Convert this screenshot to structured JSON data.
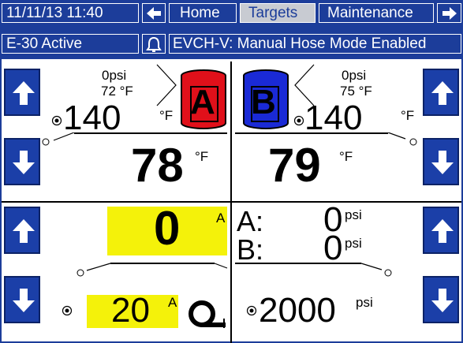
{
  "header": {
    "datetime": "11/11/13 11:40",
    "tabs": [
      "Home",
      "Targets",
      "Maintenance"
    ],
    "selected_tab": "Targets"
  },
  "status": {
    "error_code": "E-30 Active",
    "message": "EVCH-V: Manual Hose Mode Enabled"
  },
  "tank_a": {
    "label": "A",
    "pressure": "0psi",
    "actual_temp": "72 °F",
    "setpoint": "140",
    "setpoint_unit": "°F",
    "current": "78",
    "current_unit": "°F",
    "color": "#e0101a"
  },
  "tank_b": {
    "label": "B",
    "pressure": "0psi",
    "actual_temp": "75 °F",
    "setpoint": "140",
    "setpoint_unit": "°F",
    "current": "79",
    "current_unit": "°F",
    "color": "#1a2ad6"
  },
  "hose": {
    "current": "0",
    "current_unit": "A",
    "setpoint": "20",
    "setpoint_unit": "A"
  },
  "pressure": {
    "a_label": "A:",
    "a_value": "0",
    "a_unit": "psi",
    "b_label": "B:",
    "b_value": "0",
    "b_unit": "psi",
    "setpoint": "2000",
    "setpoint_unit": "psi"
  }
}
